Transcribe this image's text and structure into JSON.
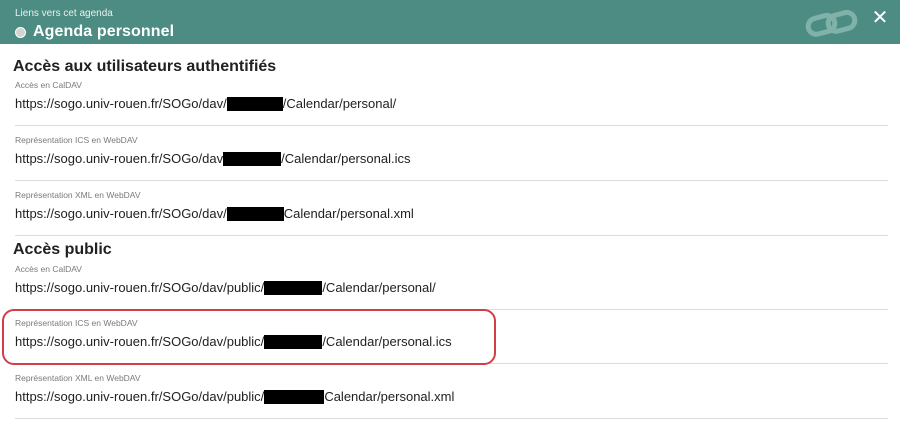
{
  "header": {
    "subtitle": "Liens vers cet agenda",
    "title": "Agenda personnel",
    "close_symbol": "✕",
    "color": "#4d8c82",
    "icons": [
      "calendar-color-dot-icon",
      "link-icon",
      "close-icon"
    ]
  },
  "sections": [
    {
      "title": "Accès aux utilisateurs authentifiés",
      "fields": [
        {
          "label": "Accès en CalDAV",
          "prefix": "https://sogo.univ-rouen.fr/SOGo/dav/",
          "suffix": "/Calendar/personal/"
        },
        {
          "label": "Représentation ICS en WebDAV",
          "prefix": "https://sogo.univ-rouen.fr/SOGo/dav",
          "suffix": "/Calendar/personal.ics"
        },
        {
          "label": "Représentation XML en WebDAV",
          "prefix": "https://sogo.univ-rouen.fr/SOGo/dav/",
          "suffix": "Calendar/personal.xml"
        }
      ]
    },
    {
      "title": "Accès public",
      "fields": [
        {
          "label": "Accès en CalDAV",
          "prefix": "https://sogo.univ-rouen.fr/SOGo/dav/public/",
          "suffix": "/Calendar/personal/"
        },
        {
          "label": "Représentation ICS en WebDAV",
          "prefix": "https://sogo.univ-rouen.fr/SOGo/dav/public/",
          "suffix": "/Calendar/personal.ics"
        },
        {
          "label": "Représentation XML en WebDAV",
          "prefix": "https://sogo.univ-rouen.fr/SOGo/dav/public/",
          "suffix": "Calendar/personal.xml"
        }
      ]
    }
  ],
  "annotation": {
    "color": "#d13f46",
    "highlighted_field": "public-ics"
  }
}
